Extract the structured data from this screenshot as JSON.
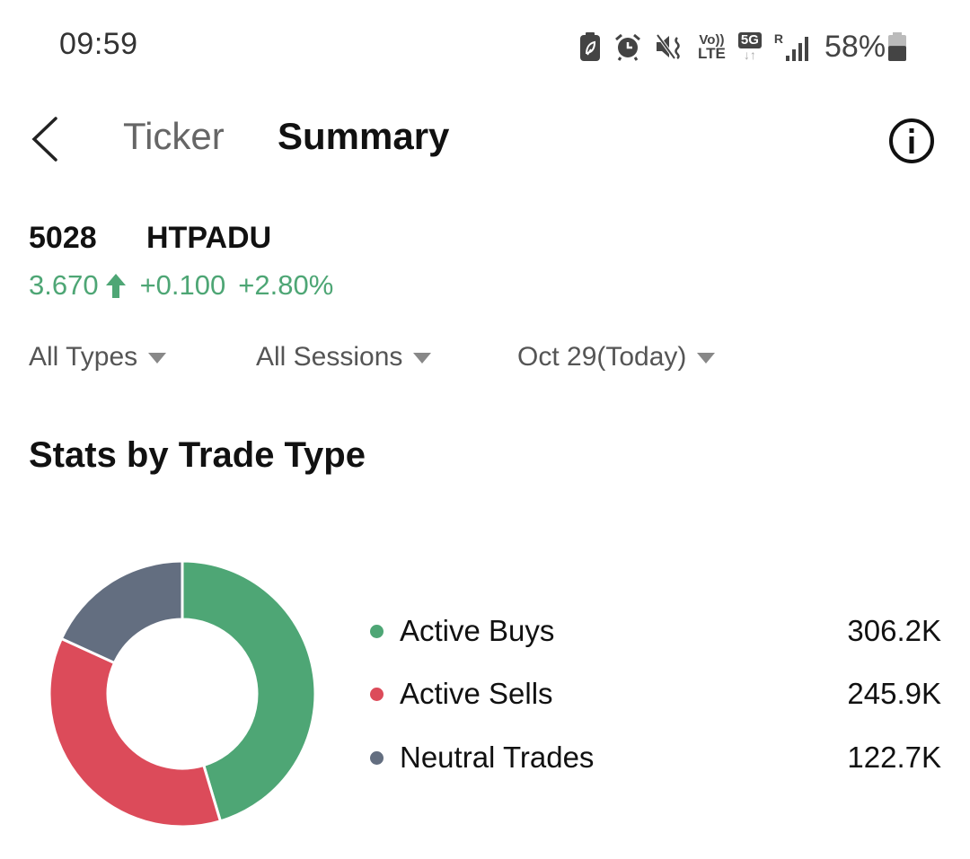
{
  "status_bar": {
    "time": "09:59",
    "icons": [
      "battery-saver-icon",
      "alarm-icon",
      "vibrate-mute-icon",
      "volte-icon",
      "5g-data-icon",
      "roaming-signal-icon"
    ],
    "volte_top": "Vo))",
    "volte_bottom": "LTE",
    "network": "5G",
    "roaming": "R",
    "battery_percent": "58%",
    "battery_level": 0.58
  },
  "header": {
    "tabs": [
      {
        "label": "Ticker",
        "active": false
      },
      {
        "label": "Summary",
        "active": true
      }
    ]
  },
  "stock": {
    "code": "5028",
    "name": "HTPADU",
    "price": "3.670",
    "change": "+0.100",
    "change_percent": "+2.80%",
    "direction": "up",
    "up_color": "#4ea675"
  },
  "filters": [
    {
      "label": "All Types"
    },
    {
      "label": "All Sessions"
    },
    {
      "label": "Oct 29(Today)"
    }
  ],
  "section": {
    "title": "Stats by Trade Type"
  },
  "chart_data": {
    "type": "pie",
    "variant": "donut",
    "title": "Stats by Trade Type",
    "start": "top",
    "direction": "clockwise",
    "legend_position": "right",
    "categories": [
      "Active Buys",
      "Active Sells",
      "Neutral Trades"
    ],
    "values": [
      306.2,
      245.9,
      122.7
    ],
    "unit": "K",
    "value_labels": [
      "306.2K",
      "245.9K",
      "122.7K"
    ],
    "colors": [
      "#4ea675",
      "#dc4b5a",
      "#636e80"
    ]
  }
}
